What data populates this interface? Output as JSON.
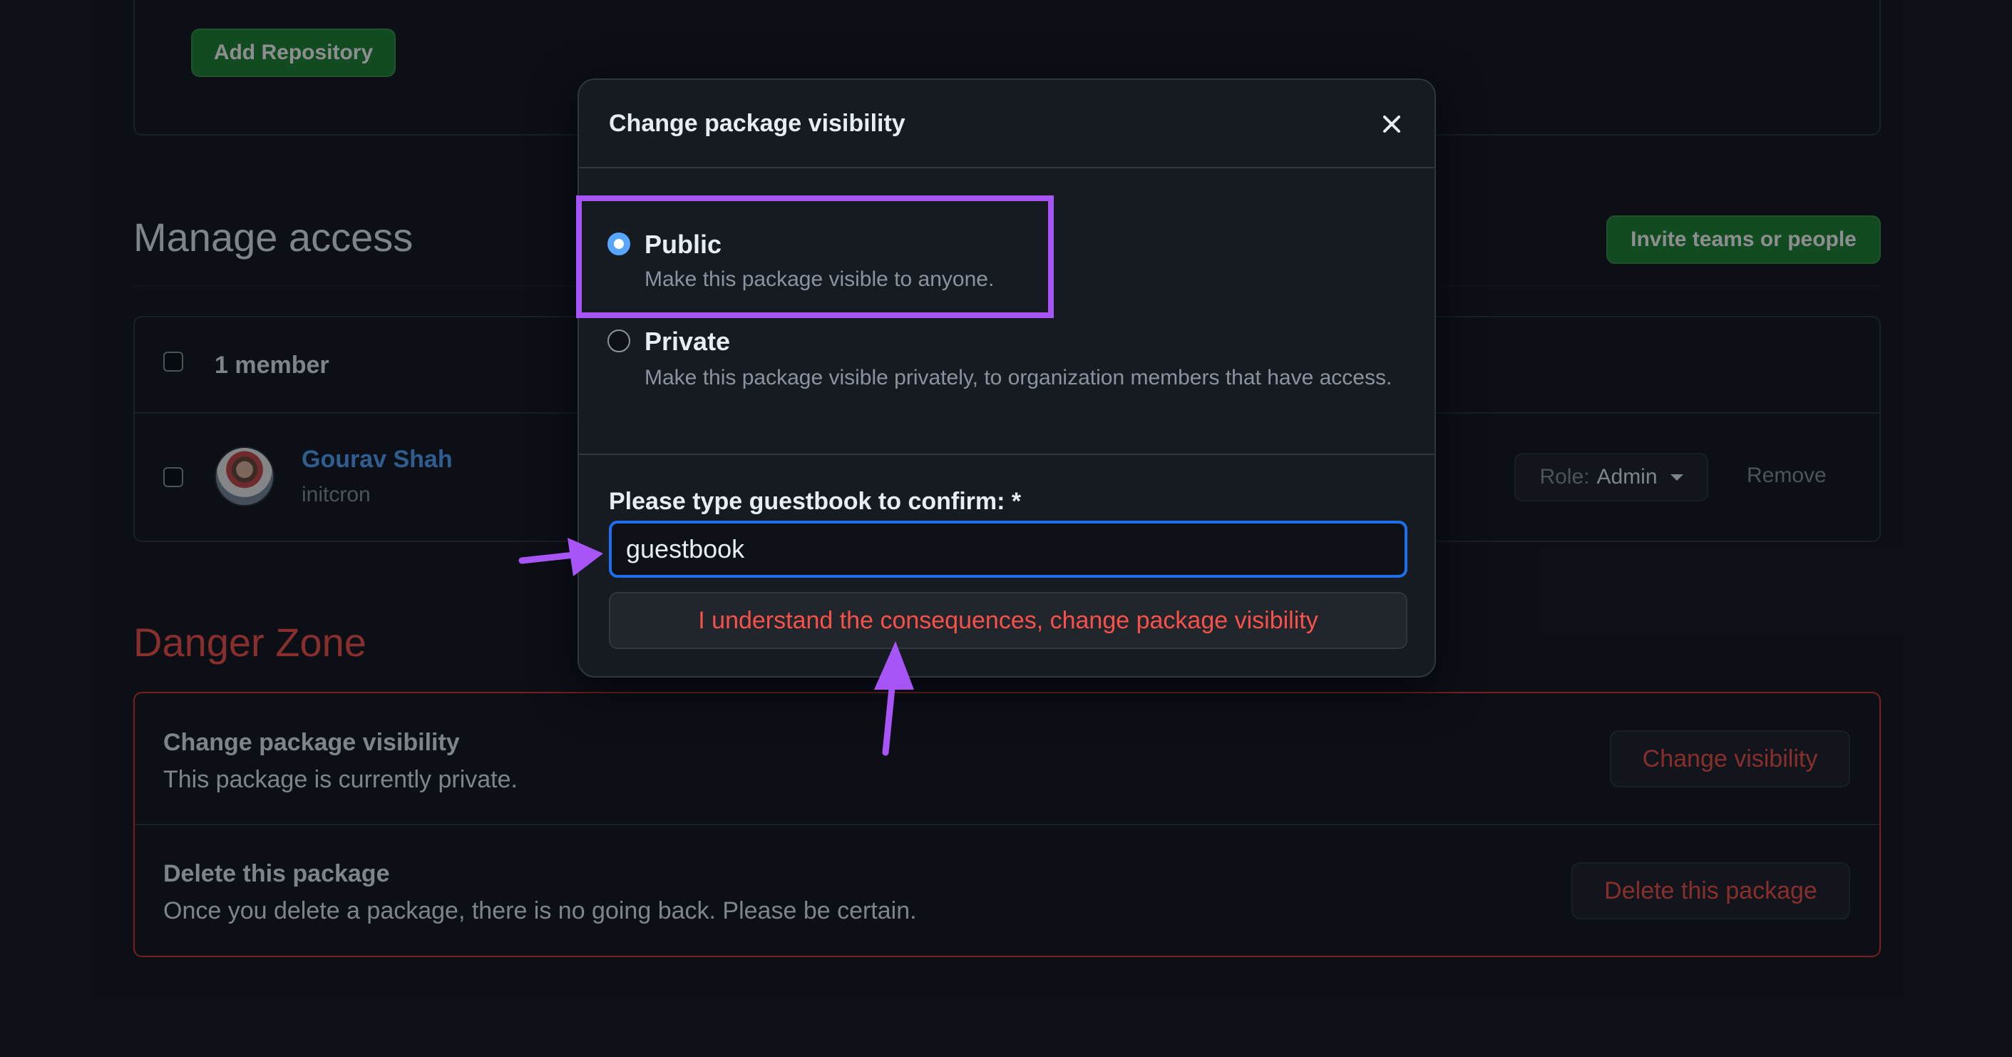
{
  "repo_section": {
    "add_repository_label": "Add Repository"
  },
  "manage_access": {
    "title": "Manage access",
    "invite_label": "Invite teams or people",
    "member_count": "1 member",
    "members": [
      {
        "name": "Gourav Shah",
        "org": "initcron",
        "role_label": "Role:",
        "role_value": "Admin",
        "remove_label": "Remove"
      }
    ]
  },
  "danger_zone": {
    "title": "Danger Zone",
    "items": [
      {
        "title": "Change package visibility",
        "description": "This package is currently private.",
        "button": "Change visibility"
      },
      {
        "title": "Delete this package",
        "description": "Once you delete a package, there is no going back. Please be certain.",
        "button": "Delete this package"
      }
    ]
  },
  "modal": {
    "title": "Change package visibility",
    "options": [
      {
        "label": "Public",
        "description": "Make this package visible to anyone.",
        "selected": true
      },
      {
        "label": "Private",
        "description": "Make this package visible privately, to organization members that have access.",
        "selected": false
      }
    ],
    "confirm_label": "Please type guestbook to confirm: *",
    "confirm_value": "guestbook",
    "confirm_button": "I understand the consequences, change package visibility"
  },
  "colors": {
    "accent": "#58a6ff",
    "danger": "#f85149",
    "success": "#238636",
    "annotation": "#a855f7"
  },
  "icons": [
    "close-icon",
    "chevron-down-icon",
    "annotation-arrow-icon"
  ]
}
